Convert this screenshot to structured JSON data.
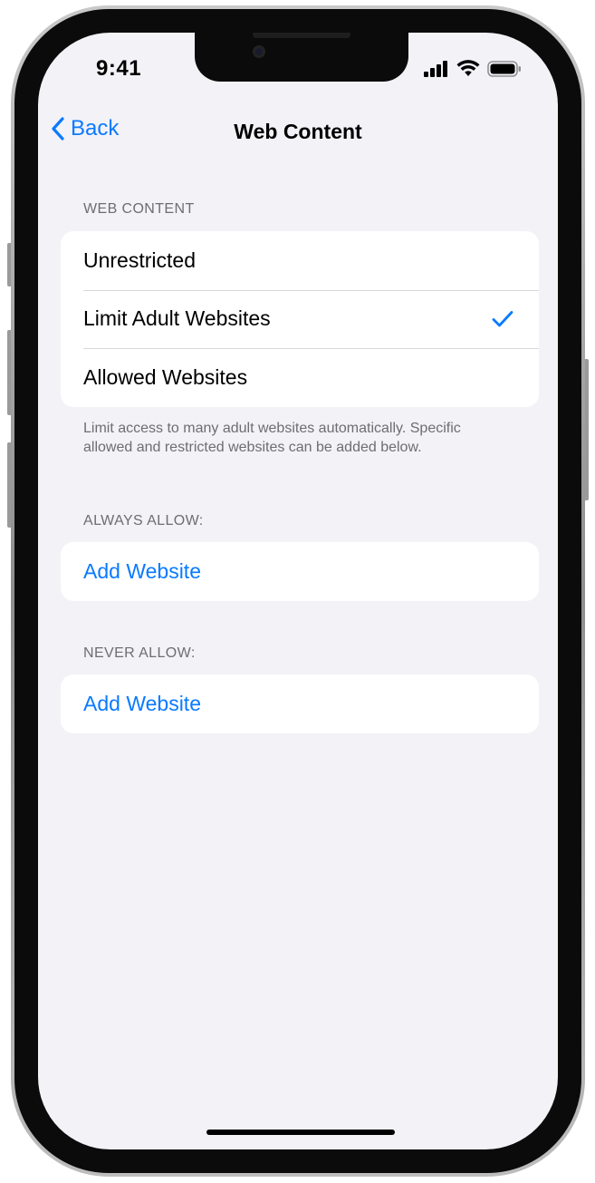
{
  "status_bar": {
    "time": "9:41",
    "icons": [
      "cellular-signal-icon",
      "wifi-icon",
      "battery-icon"
    ]
  },
  "nav": {
    "back_label": "Back",
    "title": "Web Content"
  },
  "web_content_section": {
    "header": "WEB CONTENT",
    "options": [
      {
        "label": "Unrestricted",
        "selected": false
      },
      {
        "label": "Limit Adult Websites",
        "selected": true
      },
      {
        "label": "Allowed Websites",
        "selected": false
      }
    ],
    "footer": "Limit access to many adult websites automatically. Specific allowed and restricted websites can be added below."
  },
  "always_allow_section": {
    "header": "ALWAYS ALLOW:",
    "add_label": "Add Website"
  },
  "never_allow_section": {
    "header": "NEVER ALLOW:",
    "add_label": "Add Website"
  },
  "colors": {
    "accent": "#0a7aff",
    "background": "#f2f2f7",
    "secondary_text": "#6d6d72"
  }
}
